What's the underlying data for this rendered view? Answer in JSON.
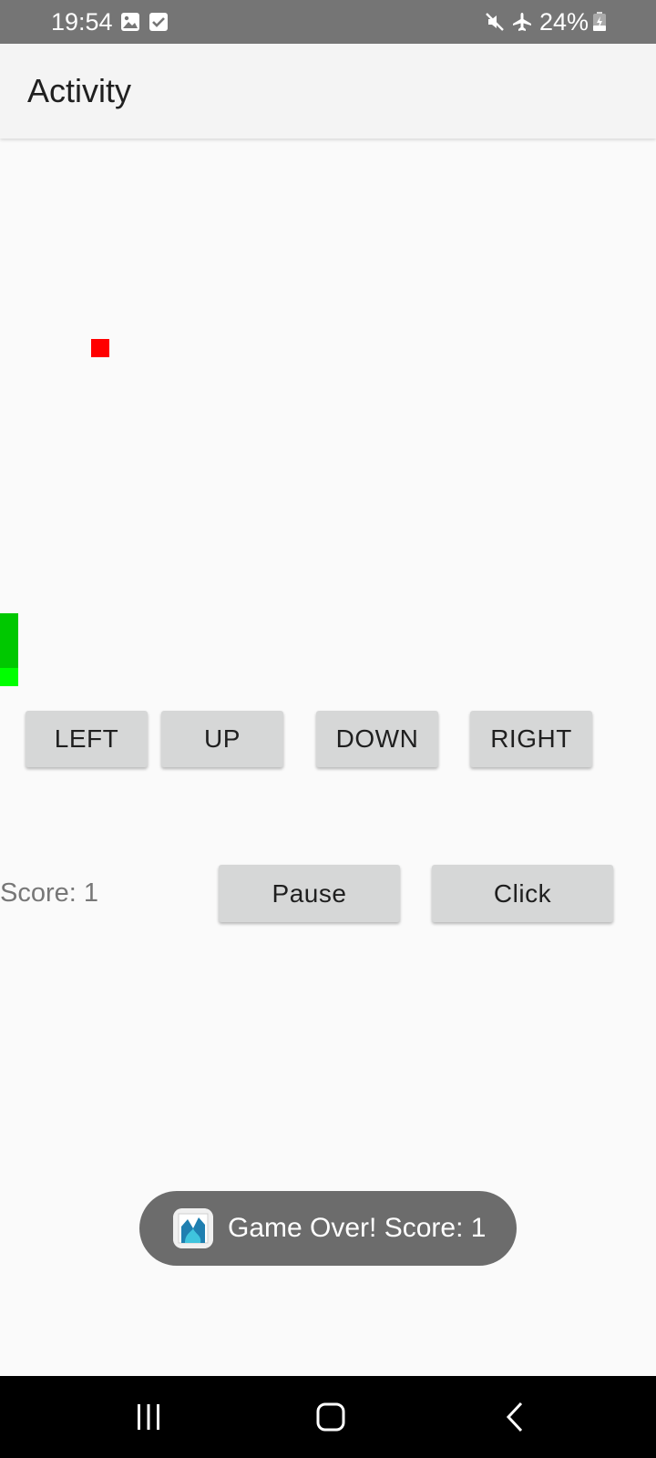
{
  "status_bar": {
    "time": "19:54",
    "battery": "24%",
    "icons": [
      "image-icon",
      "check-box-icon",
      "mute-icon",
      "airplane-icon",
      "battery-icon"
    ]
  },
  "app_bar": {
    "title": "Activity"
  },
  "game": {
    "food_color": "#ff0000",
    "snake_body_color": "#00c800",
    "snake_head_color": "#00ff00",
    "snake_length": 4
  },
  "controls": {
    "left": "LEFT",
    "up": "UP",
    "down": "DOWN",
    "right": "RIGHT",
    "pause": "Pause",
    "click": "Click"
  },
  "score": {
    "label": "Score: 1"
  },
  "toast": {
    "message": "Game Over! Score: 1",
    "icon": "app-icon"
  },
  "nav_bar": {
    "icons": [
      "recents-icon",
      "home-icon",
      "back-icon"
    ]
  },
  "colors": {
    "status_bar": "#757575",
    "app_bar": "#f4f4f4",
    "background": "#fafafa",
    "button": "#d6d7d7",
    "toast": "#6c6c6c",
    "nav_bar": "#000000"
  }
}
